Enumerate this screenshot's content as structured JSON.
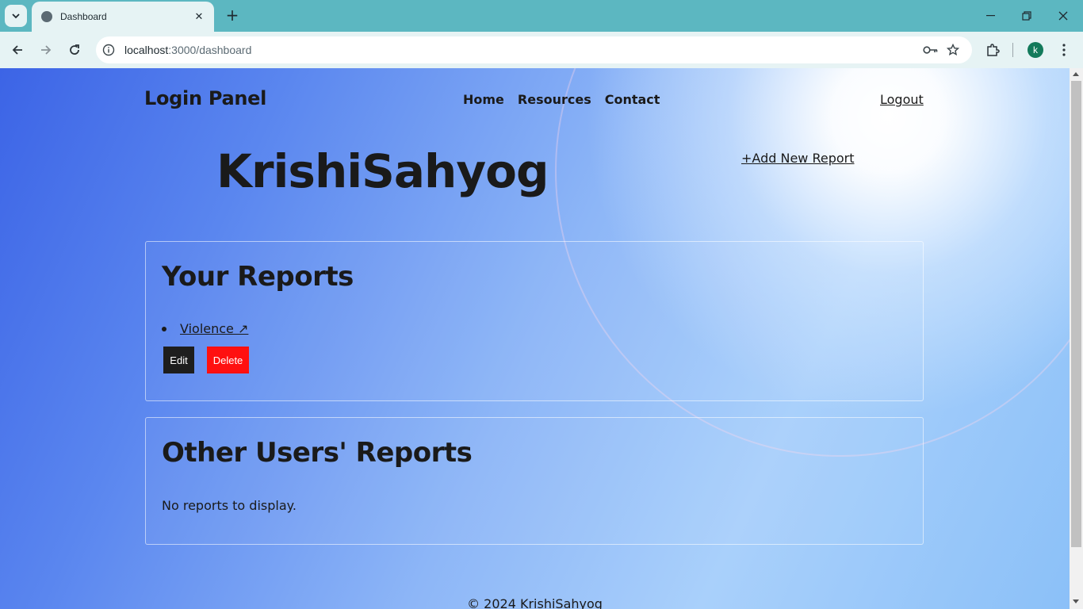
{
  "browser": {
    "tab_title": "Dashboard",
    "url_host": "localhost",
    "url_path": ":3000/dashboard",
    "profile_initial": "k"
  },
  "nav": {
    "brand": "Login Panel",
    "links": [
      "Home",
      "Resources",
      "Contact"
    ],
    "logout": "Logout"
  },
  "hero": {
    "title": "KrishiSahyog",
    "add_report": "+Add New Report"
  },
  "your_reports": {
    "heading": "Your Reports",
    "items": [
      {
        "label": "Violence ↗",
        "edit_label": "Edit",
        "delete_label": "Delete"
      }
    ]
  },
  "other_reports": {
    "heading": "Other Users' Reports",
    "empty_message": "No reports to display."
  },
  "footer": {
    "text": "© 2024 KrishiSahyog"
  },
  "colors": {
    "delete": "#ff1010",
    "edit": "#1e1e1e",
    "chrome": "#5cb7c1"
  }
}
